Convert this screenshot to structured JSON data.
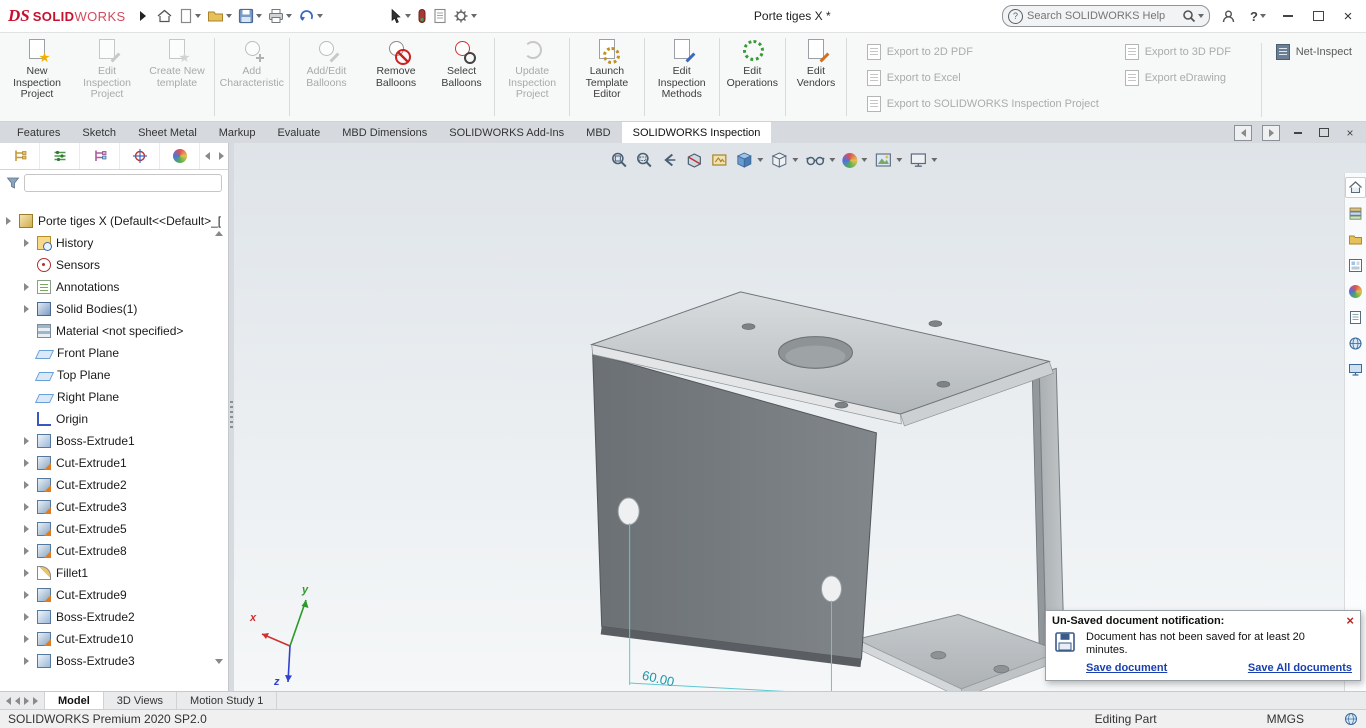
{
  "titlebar": {
    "brand_ds": "DS",
    "brand_solid": "SOLID",
    "brand_works": "WORKS",
    "document_title": "Porte tiges X *",
    "search_placeholder": "Search SOLIDWORKS Help"
  },
  "icons": {
    "help": "?",
    "close": "×"
  },
  "ribbon": {
    "buttons": [
      {
        "label": "New Inspection Project",
        "enabled": true,
        "icon": "new-inspection-project-icon"
      },
      {
        "label": "Edit Inspection Project",
        "enabled": false,
        "icon": "edit-inspection-project-icon"
      },
      {
        "label": "Create New template",
        "enabled": false,
        "icon": "create-new-template-icon"
      },
      {
        "label": "Add Characteristic",
        "enabled": false,
        "icon": "add-characteristic-icon"
      },
      {
        "label": "Add/Edit Balloons",
        "enabled": false,
        "icon": "add-edit-balloons-icon"
      },
      {
        "label": "Remove Balloons",
        "enabled": true,
        "icon": "remove-balloons-icon"
      },
      {
        "label": "Select Balloons",
        "enabled": true,
        "icon": "select-balloons-icon"
      },
      {
        "label": "Update Inspection Project",
        "enabled": false,
        "icon": "update-inspection-project-icon"
      },
      {
        "label": "Launch Template Editor",
        "enabled": true,
        "icon": "launch-template-editor-icon"
      },
      {
        "label": "Edit Inspection Methods",
        "enabled": true,
        "icon": "edit-inspection-methods-icon"
      },
      {
        "label": "Edit Operations",
        "enabled": true,
        "icon": "edit-operations-icon"
      },
      {
        "label": "Edit Vendors",
        "enabled": true,
        "icon": "edit-vendors-icon"
      }
    ],
    "export_buttons": [
      {
        "label": "Export to 2D PDF",
        "enabled": false
      },
      {
        "label": "Export to Excel",
        "enabled": false
      },
      {
        "label": "Export to SOLIDWORKS Inspection Project",
        "enabled": false
      },
      {
        "label": "Export to 3D PDF",
        "enabled": false
      },
      {
        "label": "Export eDrawing",
        "enabled": false
      },
      {
        "label": "Net-Inspect",
        "enabled": true
      }
    ]
  },
  "command_tabs": {
    "items": [
      {
        "label": "Features"
      },
      {
        "label": "Sketch"
      },
      {
        "label": "Sheet Metal"
      },
      {
        "label": "Markup"
      },
      {
        "label": "Evaluate"
      },
      {
        "label": "MBD Dimensions"
      },
      {
        "label": "SOLIDWORKS Add-Ins"
      },
      {
        "label": "MBD"
      },
      {
        "label": "SOLIDWORKS Inspection",
        "active": true
      }
    ]
  },
  "feature_tree": {
    "root_label": "Porte tiges X  (Default<<Default>_[",
    "items": [
      {
        "label": "History",
        "icon": "history-icon"
      },
      {
        "label": "Sensors",
        "icon": "sensors-icon"
      },
      {
        "label": "Annotations",
        "icon": "annotations-icon"
      },
      {
        "label": "Solid Bodies(1)",
        "icon": "solid-bodies-icon"
      },
      {
        "label": "Material <not specified>",
        "icon": "material-icon"
      },
      {
        "label": "Front Plane",
        "icon": "plane-icon"
      },
      {
        "label": "Top Plane",
        "icon": "plane-icon"
      },
      {
        "label": "Right Plane",
        "icon": "plane-icon"
      },
      {
        "label": "Origin",
        "icon": "origin-icon"
      },
      {
        "label": "Boss-Extrude1",
        "icon": "boss-extrude-icon"
      },
      {
        "label": "Cut-Extrude1",
        "icon": "cut-extrude-icon"
      },
      {
        "label": "Cut-Extrude2",
        "icon": "cut-extrude-icon"
      },
      {
        "label": "Cut-Extrude3",
        "icon": "cut-extrude-icon"
      },
      {
        "label": "Cut-Extrude5",
        "icon": "cut-extrude-icon"
      },
      {
        "label": "Cut-Extrude8",
        "icon": "cut-extrude-icon"
      },
      {
        "label": "Fillet1",
        "icon": "fillet-icon"
      },
      {
        "label": "Cut-Extrude9",
        "icon": "cut-extrude-icon"
      },
      {
        "label": "Boss-Extrude2",
        "icon": "boss-extrude-icon"
      },
      {
        "label": "Cut-Extrude10",
        "icon": "cut-extrude-icon"
      },
      {
        "label": "Boss-Extrude3",
        "icon": "boss-extrude-icon"
      }
    ]
  },
  "viewport": {
    "dimension_label": "60.00",
    "triad": {
      "x": "x",
      "y": "y",
      "z": "z"
    }
  },
  "notification": {
    "title": "Un-Saved document notification:",
    "message": "Document has not been saved for at least 20 minutes.",
    "save_link": "Save document",
    "save_all_link": "Save All documents"
  },
  "bottom_tabs": {
    "items": [
      {
        "label": "Model",
        "active": true
      },
      {
        "label": "3D Views"
      },
      {
        "label": "Motion Study 1"
      }
    ]
  },
  "statusbar": {
    "left": "SOLIDWORKS Premium 2020 SP2.0",
    "mode": "Editing Part",
    "units": "MMGS"
  }
}
